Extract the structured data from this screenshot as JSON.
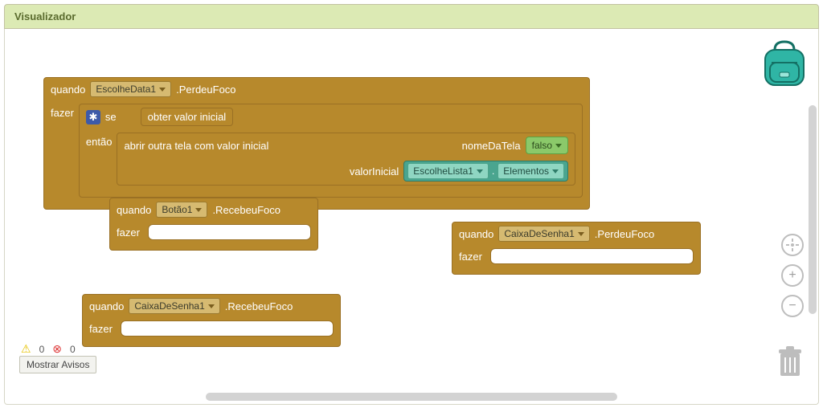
{
  "header": {
    "title": "Visualizador"
  },
  "labels": {
    "quando": "quando",
    "fazer": "fazer",
    "se": "se",
    "entao": "então",
    "obter_valor_inicial": "obter valor inicial",
    "abrir_tela": "abrir outra tela com valor inicial",
    "nomeDaTela": "nomeDaTela",
    "valorInicial": "valorInicial",
    "falso": "falso",
    "dot": "."
  },
  "blocks": {
    "b1": {
      "component": "EscolheData1",
      "event": ".PerdeuFoco"
    },
    "b2": {
      "component": "Botão1",
      "event": ".RecebeuFoco"
    },
    "b3": {
      "component": "CaixaDeSenha1",
      "event": ".PerdeuFoco"
    },
    "b4": {
      "component": "CaixaDeSenha1",
      "event": ".RecebeuFoco"
    },
    "teal": {
      "component": "EscolheLista1",
      "property": "Elementos"
    }
  },
  "status": {
    "warnings": "0",
    "errors": "0",
    "show_button": "Mostrar Avisos"
  },
  "chart_data": null
}
